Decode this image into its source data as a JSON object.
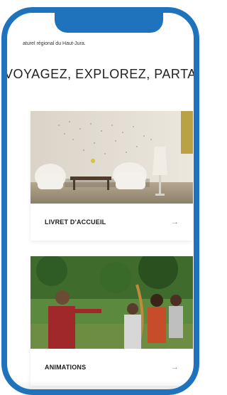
{
  "header": {
    "subtitle": "aturel régional du Haut-Jura.",
    "tagline": "VOYAGEZ, EXPLOREZ, PARTAGEZ..."
  },
  "cards": [
    {
      "label": "LIVRET D'ACCUEIL",
      "arrow": "→",
      "image": "lounge-photo"
    },
    {
      "label": "ANIMATIONS",
      "arrow": "→",
      "image": "archery-photo"
    }
  ],
  "colors": {
    "frame": "#1f73bd",
    "text": "#222222",
    "arrow": "#8b8b8b"
  }
}
